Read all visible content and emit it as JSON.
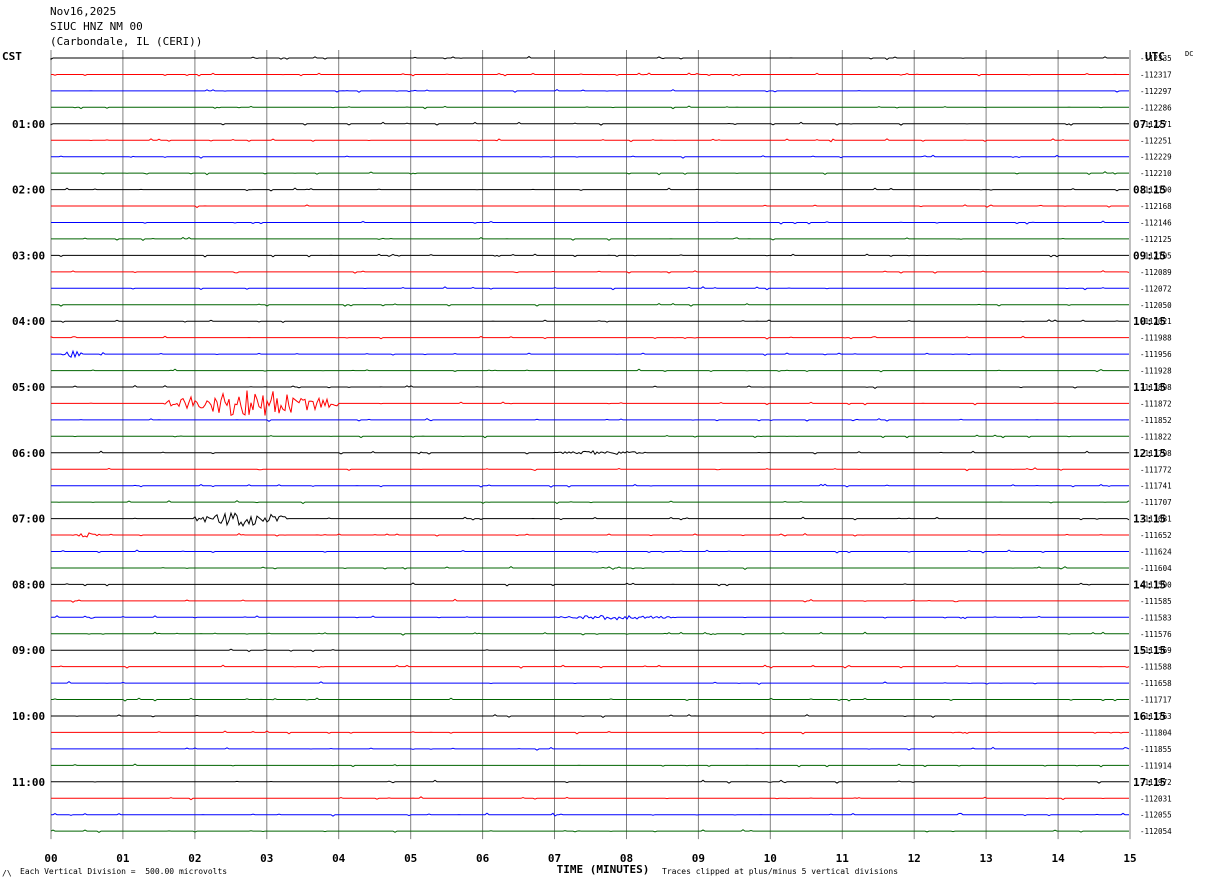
{
  "header": {
    "date": "Nov16,2025",
    "station": "SIUC HNZ NM 00",
    "location": "(Carbondale, IL (CERI))"
  },
  "labels": {
    "left_tz": "CST",
    "right_tz": "UTC",
    "dc": "DC",
    "scale_note": "Each Vertical Division =  500.00 microvolts",
    "clip_note": "Traces clipped at plus/minus 5 vertical divisions",
    "corner_mark": "/\\"
  },
  "colors": {
    "trace_cycle": [
      "#000000",
      "#ff0000",
      "#0000ff",
      "#006400"
    ],
    "grid": "#808080"
  },
  "chart_data": {
    "type": "line",
    "title": "",
    "xlabel": "TIME (MINUTES)",
    "ylabel": "",
    "xlim": [
      0,
      15
    ],
    "x_ticks": [
      "00",
      "01",
      "02",
      "03",
      "04",
      "05",
      "06",
      "07",
      "08",
      "09",
      "10",
      "11",
      "12",
      "13",
      "14",
      "15"
    ],
    "grid": true,
    "minutes_per_trace": 15,
    "trace_count": 48,
    "left_hour_labels": [
      "01:00",
      "02:00",
      "03:00",
      "04:00",
      "05:00",
      "06:00",
      "07:00",
      "08:00",
      "09:00",
      "10:00",
      "11:00"
    ],
    "right_hour_labels": [
      "07:15",
      "08:15",
      "09:15",
      "10:15",
      "11:15",
      "12:15",
      "13:15",
      "14:15",
      "15:15",
      "16:15",
      "17:15"
    ],
    "dc_offsets": [
      "-112335",
      "-112317",
      "-112297",
      "-112286",
      "-112271",
      "-112251",
      "-112229",
      "-112210",
      "-112190",
      "-112168",
      "-112146",
      "-112125",
      "-112105",
      "-112089",
      "-112072",
      "-112050",
      "-112021",
      "-111988",
      "-111956",
      "-111928",
      "-111898",
      "-111872",
      "-111852",
      "-111822",
      "-111798",
      "-111772",
      "-111741",
      "-111707",
      "-111681",
      "-111652",
      "-111624",
      "-111604",
      "-111590",
      "-111585",
      "-111583",
      "-111576",
      "-111569",
      "-111588",
      "-111658",
      "-111717",
      "-111763",
      "-111804",
      "-111855",
      "-111914",
      "-111972",
      "-112031",
      "-112055",
      "-112054"
    ],
    "events": [
      {
        "trace": 18,
        "start_min": 0.15,
        "end_min": 0.45,
        "amplitude": 3
      },
      {
        "trace": 21,
        "start_min": 1.6,
        "end_min": 4.0,
        "amplitude": 12
      },
      {
        "trace": 24,
        "start_min": 7.0,
        "end_min": 8.3,
        "amplitude": 2
      },
      {
        "trace": 28,
        "start_min": 2.0,
        "end_min": 3.3,
        "amplitude": 7
      },
      {
        "trace": 29,
        "start_min": 0.3,
        "end_min": 0.7,
        "amplitude": 2
      },
      {
        "trace": 34,
        "start_min": 7.0,
        "end_min": 8.7,
        "amplitude": 2
      }
    ]
  }
}
